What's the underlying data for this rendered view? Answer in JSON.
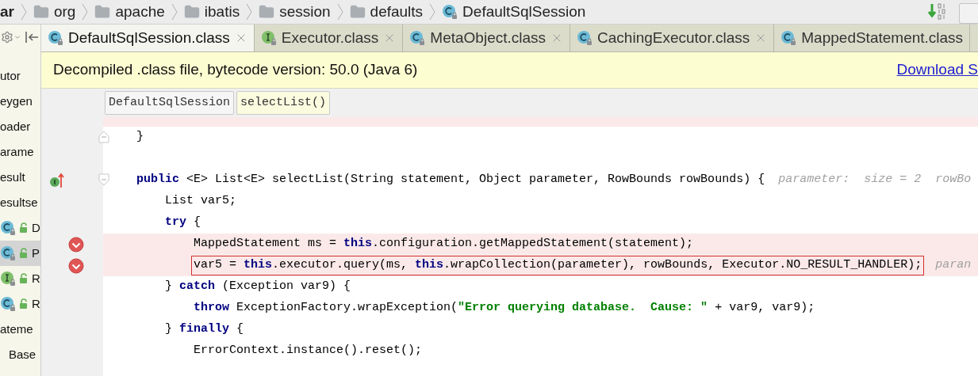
{
  "breadcrumb": [
    {
      "text": "ar",
      "kind": "module"
    },
    {
      "text": "org",
      "kind": "package"
    },
    {
      "text": "apache",
      "kind": "package"
    },
    {
      "text": "ibatis",
      "kind": "package"
    },
    {
      "text": "session",
      "kind": "package"
    },
    {
      "text": "defaults",
      "kind": "package"
    },
    {
      "text": "DefaultSqlSession",
      "kind": "class"
    }
  ],
  "tabs": [
    {
      "label": "DefaultSqlSession.class",
      "kind": "class",
      "selected": true
    },
    {
      "label": "Executor.class",
      "kind": "interface",
      "selected": false
    },
    {
      "label": "MetaObject.class",
      "kind": "class",
      "selected": false
    },
    {
      "label": "CachingExecutor.class",
      "kind": "class",
      "selected": false
    },
    {
      "label": "MappedStatement.class",
      "kind": "class",
      "selected": false
    }
  ],
  "banner": {
    "text": "Decompiled .class file, bytecode version: 50.0 (Java 6)",
    "link": "Download S"
  },
  "sidebar": {
    "items": [
      {
        "text": "utor",
        "selected": false
      },
      {
        "text": "eygen",
        "selected": false
      },
      {
        "text": "oader",
        "selected": false
      },
      {
        "text": "arame",
        "selected": false
      },
      {
        "text": "esult",
        "selected": false
      },
      {
        "text": "esultse",
        "selected": false
      },
      {
        "text": "D",
        "kind": "class",
        "selected": false
      },
      {
        "text": "P",
        "kind": "class",
        "selected": true
      },
      {
        "text": "R",
        "kind": "interface",
        "selected": false
      },
      {
        "text": "R",
        "kind": "class",
        "selected": false
      },
      {
        "text": "ateme",
        "selected": false,
        "children": [
          {
            "text": "Base",
            "selected": false
          }
        ]
      }
    ]
  },
  "editor_breadcrumb": [
    {
      "text": "DefaultSqlSession",
      "selected": false
    },
    {
      "text": "selectList()",
      "selected": true
    }
  ],
  "code": [
    {
      "kind": "block_end",
      "boxed": false,
      "segments": [
        {
          "kind": "plain",
          "text": "}"
        }
      ]
    },
    {
      "kind": "method",
      "boxed": false,
      "segments": [
        {
          "kind": "keyword",
          "text": "public"
        },
        {
          "kind": "plain",
          "text": " <E> List<E> selectList(String statement, Object parameter, RowBounds rowBounds) {"
        }
      ],
      "hint": "parameter:  size = 2  rowBo",
      "children": [
        {
          "kind": "plain",
          "boxed": false,
          "segments": [
            {
              "kind": "plain",
              "text": "List var5;"
            }
          ]
        },
        {
          "kind": "plain",
          "boxed": false,
          "segments": [
            {
              "kind": "keyword",
              "text": "try"
            },
            {
              "kind": "plain",
              "text": " {"
            }
          ],
          "children": [
            {
              "kind": "breakpoint",
              "boxed": false,
              "segments": [
                {
                  "kind": "plain",
                  "text": "MappedStatement ms = "
                },
                {
                  "kind": "keyword",
                  "text": "this"
                },
                {
                  "kind": "plain",
                  "text": ".configuration.getMappedStatement(statement);"
                }
              ]
            },
            {
              "kind": "breakpoint",
              "boxed": true,
              "segments": [
                {
                  "kind": "plain",
                  "text": "var5 = "
                },
                {
                  "kind": "keyword",
                  "text": "this"
                },
                {
                  "kind": "plain",
                  "text": ".executor.query(ms, "
                },
                {
                  "kind": "keyword",
                  "text": "this"
                },
                {
                  "kind": "plain",
                  "text": ".wrapCollection(parameter), rowBounds, Executor.NO_RESULT_HANDLER);"
                }
              ],
              "hint": "paran"
            }
          ]
        },
        {
          "kind": "plain",
          "boxed": false,
          "segments": [
            {
              "kind": "plain",
              "text": "} "
            },
            {
              "kind": "keyword",
              "text": "catch"
            },
            {
              "kind": "plain",
              "text": " (Exception var9) {"
            }
          ],
          "children": [
            {
              "kind": "plain",
              "boxed": false,
              "segments": [
                {
                  "kind": "keyword",
                  "text": "throw"
                },
                {
                  "kind": "plain",
                  "text": " ExceptionFactory.wrapException("
                },
                {
                  "kind": "string",
                  "text": "\"Error querying database.  Cause: \""
                },
                {
                  "kind": "plain",
                  "text": " + var9, var9);"
                }
              ]
            }
          ]
        },
        {
          "kind": "plain",
          "boxed": false,
          "segments": [
            {
              "kind": "plain",
              "text": "} "
            },
            {
              "kind": "keyword",
              "text": "finally"
            },
            {
              "kind": "plain",
              "text": " {"
            }
          ],
          "children": [
            {
              "kind": "plain",
              "boxed": false,
              "segments": [
                {
                  "kind": "plain",
                  "text": "ErrorContext.instance().reset();"
                }
              ]
            }
          ]
        }
      ]
    }
  ]
}
